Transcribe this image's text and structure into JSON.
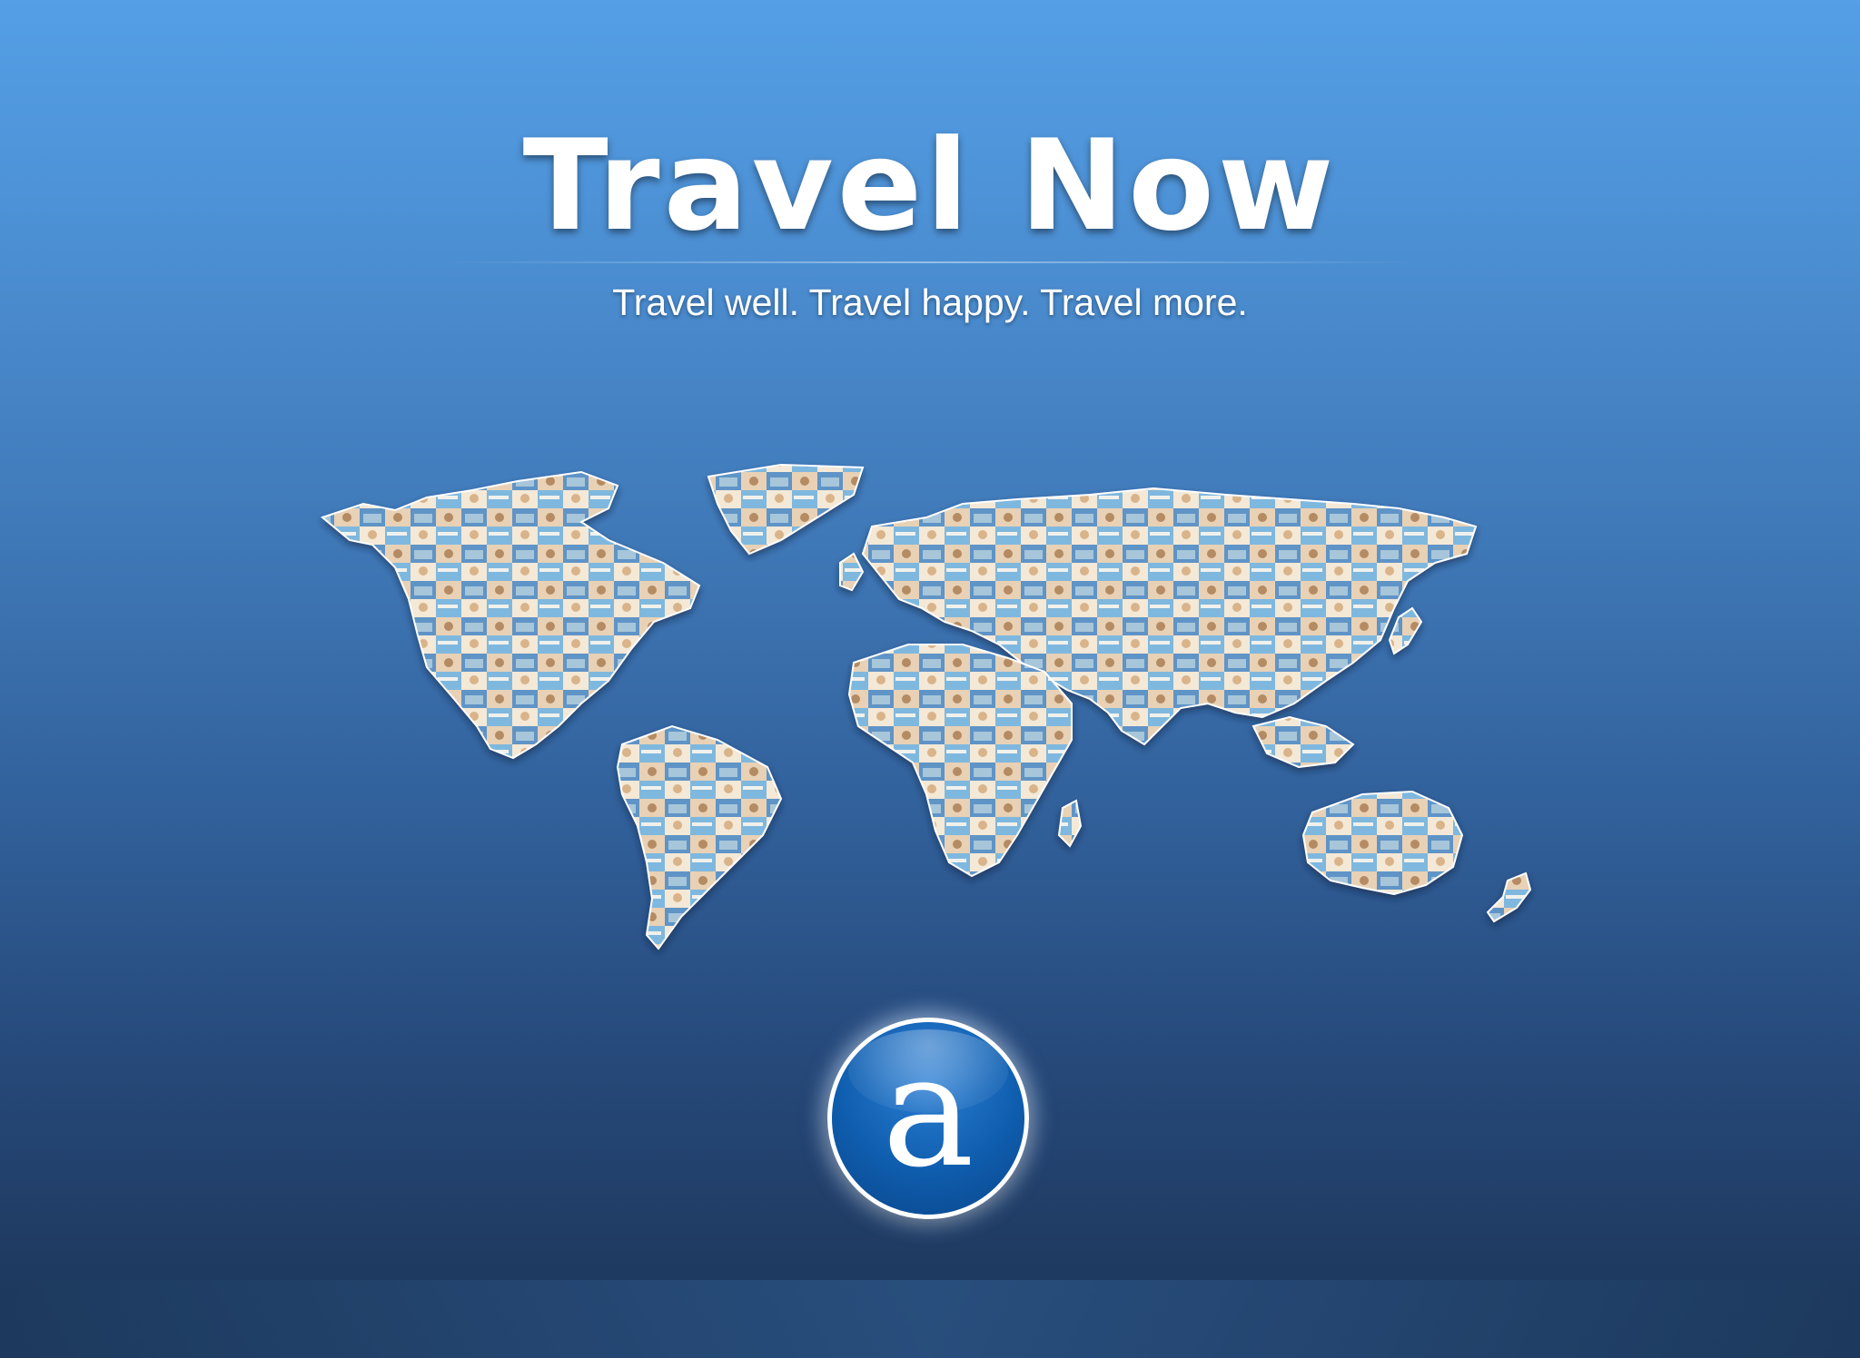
{
  "title": "Travel Now",
  "tagline": "Travel well. Travel happy. Travel more.",
  "logo": {
    "letter": "a",
    "color": "#0f5dae"
  },
  "map": {
    "icon": "world-map-photo-collage",
    "tile_colors": [
      "#f4e8d6",
      "#d9b48a",
      "#7fb8de",
      "#c9d8e4",
      "#5e94c7",
      "#e8d1b5",
      "#a7c6d9",
      "#f1f1ec",
      "#3c70a8",
      "#b48b63",
      "#8fc3a9",
      "#dce9f3"
    ]
  },
  "colors": {
    "background_top": "#549fe6",
    "background_bottom": "#1c3456",
    "text": "#ffffff"
  }
}
